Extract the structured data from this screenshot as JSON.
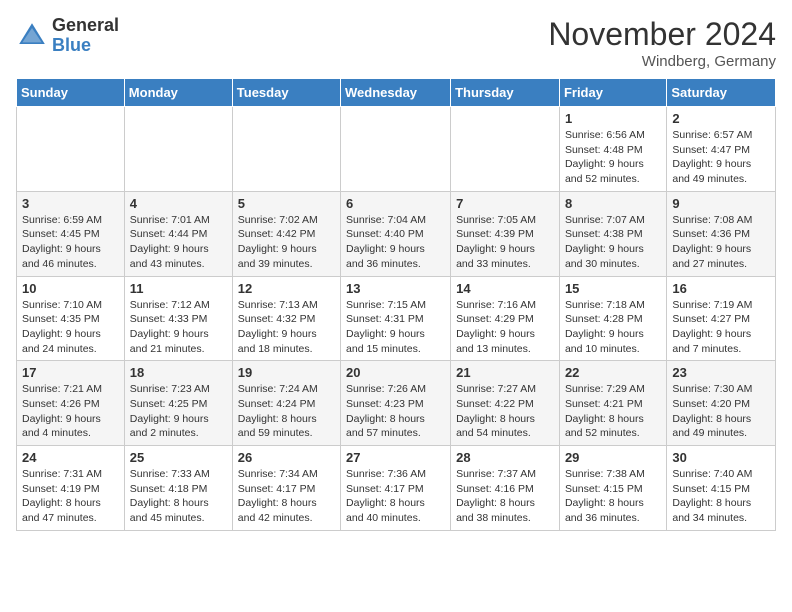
{
  "header": {
    "logo_general": "General",
    "logo_blue": "Blue",
    "month_title": "November 2024",
    "location": "Windberg, Germany"
  },
  "days_of_week": [
    "Sunday",
    "Monday",
    "Tuesday",
    "Wednesday",
    "Thursday",
    "Friday",
    "Saturday"
  ],
  "weeks": [
    [
      {
        "day": "",
        "info": ""
      },
      {
        "day": "",
        "info": ""
      },
      {
        "day": "",
        "info": ""
      },
      {
        "day": "",
        "info": ""
      },
      {
        "day": "",
        "info": ""
      },
      {
        "day": "1",
        "info": "Sunrise: 6:56 AM\nSunset: 4:48 PM\nDaylight: 9 hours\nand 52 minutes."
      },
      {
        "day": "2",
        "info": "Sunrise: 6:57 AM\nSunset: 4:47 PM\nDaylight: 9 hours\nand 49 minutes."
      }
    ],
    [
      {
        "day": "3",
        "info": "Sunrise: 6:59 AM\nSunset: 4:45 PM\nDaylight: 9 hours\nand 46 minutes."
      },
      {
        "day": "4",
        "info": "Sunrise: 7:01 AM\nSunset: 4:44 PM\nDaylight: 9 hours\nand 43 minutes."
      },
      {
        "day": "5",
        "info": "Sunrise: 7:02 AM\nSunset: 4:42 PM\nDaylight: 9 hours\nand 39 minutes."
      },
      {
        "day": "6",
        "info": "Sunrise: 7:04 AM\nSunset: 4:40 PM\nDaylight: 9 hours\nand 36 minutes."
      },
      {
        "day": "7",
        "info": "Sunrise: 7:05 AM\nSunset: 4:39 PM\nDaylight: 9 hours\nand 33 minutes."
      },
      {
        "day": "8",
        "info": "Sunrise: 7:07 AM\nSunset: 4:38 PM\nDaylight: 9 hours\nand 30 minutes."
      },
      {
        "day": "9",
        "info": "Sunrise: 7:08 AM\nSunset: 4:36 PM\nDaylight: 9 hours\nand 27 minutes."
      }
    ],
    [
      {
        "day": "10",
        "info": "Sunrise: 7:10 AM\nSunset: 4:35 PM\nDaylight: 9 hours\nand 24 minutes."
      },
      {
        "day": "11",
        "info": "Sunrise: 7:12 AM\nSunset: 4:33 PM\nDaylight: 9 hours\nand 21 minutes."
      },
      {
        "day": "12",
        "info": "Sunrise: 7:13 AM\nSunset: 4:32 PM\nDaylight: 9 hours\nand 18 minutes."
      },
      {
        "day": "13",
        "info": "Sunrise: 7:15 AM\nSunset: 4:31 PM\nDaylight: 9 hours\nand 15 minutes."
      },
      {
        "day": "14",
        "info": "Sunrise: 7:16 AM\nSunset: 4:29 PM\nDaylight: 9 hours\nand 13 minutes."
      },
      {
        "day": "15",
        "info": "Sunrise: 7:18 AM\nSunset: 4:28 PM\nDaylight: 9 hours\nand 10 minutes."
      },
      {
        "day": "16",
        "info": "Sunrise: 7:19 AM\nSunset: 4:27 PM\nDaylight: 9 hours\nand 7 minutes."
      }
    ],
    [
      {
        "day": "17",
        "info": "Sunrise: 7:21 AM\nSunset: 4:26 PM\nDaylight: 9 hours\nand 4 minutes."
      },
      {
        "day": "18",
        "info": "Sunrise: 7:23 AM\nSunset: 4:25 PM\nDaylight: 9 hours\nand 2 minutes."
      },
      {
        "day": "19",
        "info": "Sunrise: 7:24 AM\nSunset: 4:24 PM\nDaylight: 8 hours\nand 59 minutes."
      },
      {
        "day": "20",
        "info": "Sunrise: 7:26 AM\nSunset: 4:23 PM\nDaylight: 8 hours\nand 57 minutes."
      },
      {
        "day": "21",
        "info": "Sunrise: 7:27 AM\nSunset: 4:22 PM\nDaylight: 8 hours\nand 54 minutes."
      },
      {
        "day": "22",
        "info": "Sunrise: 7:29 AM\nSunset: 4:21 PM\nDaylight: 8 hours\nand 52 minutes."
      },
      {
        "day": "23",
        "info": "Sunrise: 7:30 AM\nSunset: 4:20 PM\nDaylight: 8 hours\nand 49 minutes."
      }
    ],
    [
      {
        "day": "24",
        "info": "Sunrise: 7:31 AM\nSunset: 4:19 PM\nDaylight: 8 hours\nand 47 minutes."
      },
      {
        "day": "25",
        "info": "Sunrise: 7:33 AM\nSunset: 4:18 PM\nDaylight: 8 hours\nand 45 minutes."
      },
      {
        "day": "26",
        "info": "Sunrise: 7:34 AM\nSunset: 4:17 PM\nDaylight: 8 hours\nand 42 minutes."
      },
      {
        "day": "27",
        "info": "Sunrise: 7:36 AM\nSunset: 4:17 PM\nDaylight: 8 hours\nand 40 minutes."
      },
      {
        "day": "28",
        "info": "Sunrise: 7:37 AM\nSunset: 4:16 PM\nDaylight: 8 hours\nand 38 minutes."
      },
      {
        "day": "29",
        "info": "Sunrise: 7:38 AM\nSunset: 4:15 PM\nDaylight: 8 hours\nand 36 minutes."
      },
      {
        "day": "30",
        "info": "Sunrise: 7:40 AM\nSunset: 4:15 PM\nDaylight: 8 hours\nand 34 minutes."
      }
    ]
  ]
}
